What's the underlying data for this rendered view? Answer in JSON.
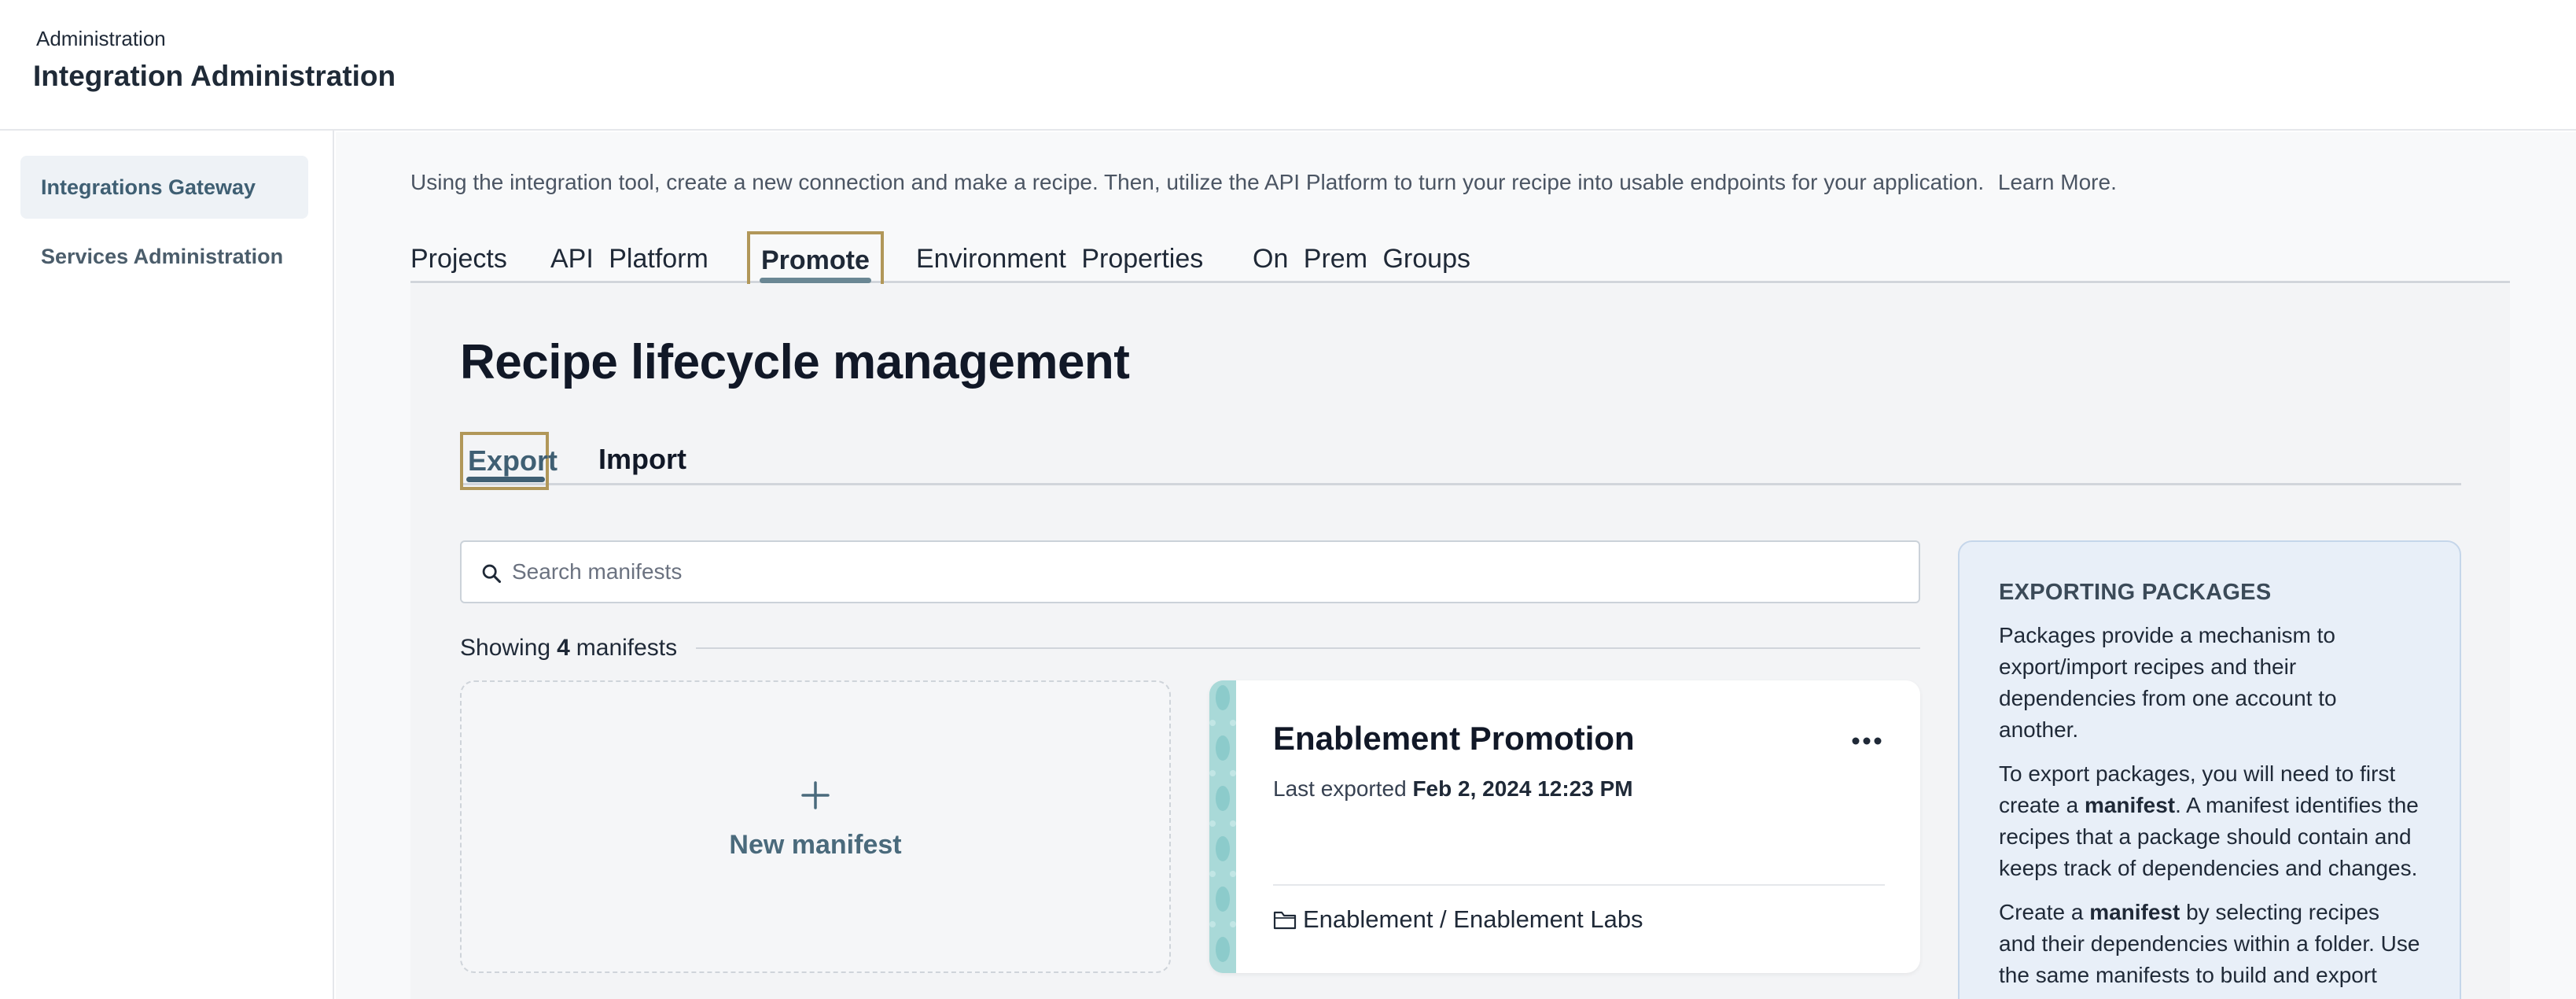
{
  "header": {
    "breadcrumb": "Administration",
    "title": "Integration Administration"
  },
  "sidebar": {
    "items": [
      {
        "label": "Integrations Gateway",
        "active": true
      },
      {
        "label": "Services Administration",
        "active": false
      }
    ]
  },
  "main": {
    "intro_text": "Using the integration tool, create a new connection and make a recipe. Then, utilize the API Platform to turn your recipe into usable endpoints for your application.",
    "learn_more": "Learn More.",
    "tabs": [
      {
        "label": "Projects"
      },
      {
        "label": "API Platform"
      },
      {
        "label": "Promote",
        "active": true
      },
      {
        "label": "Environment Properties"
      },
      {
        "label": "On Prem Groups"
      }
    ],
    "page_heading": "Recipe lifecycle management",
    "subtabs": [
      {
        "label": "Export",
        "active": true
      },
      {
        "label": "Import"
      }
    ],
    "search": {
      "placeholder": "Search manifests",
      "value": ""
    },
    "showing": {
      "prefix": "Showing",
      "count": "4",
      "suffix": "manifests"
    },
    "new_manifest_label": "New manifest",
    "manifest_card": {
      "title": "Enablement Promotion",
      "exported_prefix": "Last exported",
      "exported_date": "Feb 2, 2024 12:23 PM",
      "folder_path": "Enablement / Enablement Labs",
      "stripe_color": "#9fd3d3"
    },
    "info_panel": {
      "heading": "EXPORTING PACKAGES",
      "p1": "Packages provide a mechanism to export/import recipes and their dependencies from one account to another.",
      "p2_a": "To export packages, you will need to first create a",
      "p2_bold": "manifest",
      "p2_b": ". A manifest identifies the recipes that a package should contain and keeps track of dependencies and changes.",
      "p3_a": "Create a",
      "p3_bold": "manifest",
      "p3_b": "by selecting recipes and their dependencies within a folder. Use the same manifests to build and export"
    }
  },
  "colors": {
    "accent": "#3f5f73",
    "focus_outline": "#b19759",
    "info_bg": "#e8eff8"
  }
}
